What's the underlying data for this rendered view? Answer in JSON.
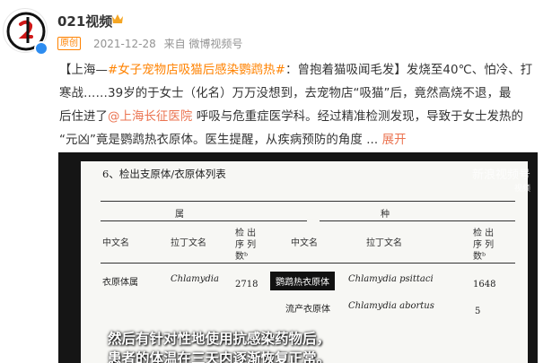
{
  "header": {
    "user_name": "021视频",
    "badge": "原创",
    "date": "2021-12-28",
    "source": "来自 微博视频号"
  },
  "post": {
    "l1_a": "【上海—",
    "l1_tag": "#女子宠物店吸猫后感染鹦鹉热#",
    "l1_b": "：曾抱着猫吸闻毛发】发烧至40℃、怕冷、打",
    "l2": "寒战……39岁的于女士（化名）万万没想到，去宠物店“吸猫”后，竟然高烧不退，最",
    "l3_a": "后住进了",
    "l3_link": "@上海长征医院",
    "l3_b": " 呼吸与危重症医学科。经过精准检测发现，导致于女士发热的",
    "l4_a": "“元凶”竟是鹦鹉热衣原体。医生提醒，从疾病预防的角度 ... ",
    "l4_more": "展开"
  },
  "video": {
    "section_title": "6、检出支原体/衣原体列表",
    "col_genus": "属",
    "col_species": "种",
    "col_cn": "中文名",
    "col_latin": "拉丁文名",
    "col_count_1": "检 出",
    "col_count_2": "序 列",
    "col_count_3": "数ᵇ",
    "col_cn2": "中文名",
    "col_latin2": "拉丁文名",
    "row1": {
      "genus_cn": "衣原体属",
      "genus_latin": "Chlamydia",
      "genus_count": "2718",
      "species_cn": "鹦鹉热衣原体",
      "species_latin": "Chlamydia psittaci",
      "species_count": "1648"
    },
    "row2": {
      "species_cn": "流产衣原体",
      "species_latin": "Chlamydia abortus",
      "species_count": "5"
    },
    "watermark": "新浪视频号",
    "watermark_sub": "视频",
    "subtitle_1": "然后有针对性地使用抗感染药物后，",
    "subtitle_2": "患者的体温在三天内逐渐恢复正常。"
  },
  "colors": {
    "orange": "#ff8200",
    "link": "#eb7350",
    "verify": "#2d8cf0"
  }
}
